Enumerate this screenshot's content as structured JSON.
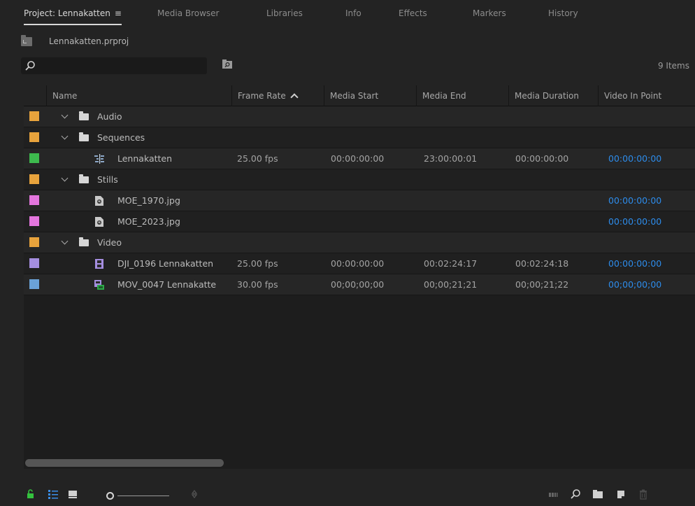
{
  "tabs": [
    {
      "label": "Project: Lennakatten",
      "menu": "≡",
      "active": true
    },
    {
      "label": "Media Browser",
      "active": false
    },
    {
      "label": "Libraries",
      "active": false
    },
    {
      "label": "Info",
      "active": false
    },
    {
      "label": "Effects",
      "active": false
    },
    {
      "label": "Markers",
      "active": false
    },
    {
      "label": "History",
      "active": false
    }
  ],
  "project": {
    "filename": "Lennakatten.prproj"
  },
  "search": {
    "value": "",
    "placeholder": ""
  },
  "items_count": "9 Items",
  "columns": [
    "Name",
    "Frame Rate",
    "Media Start",
    "Media End",
    "Media Duration",
    "Video In Point"
  ],
  "rows": [
    {
      "type": "bin",
      "name": "Audio",
      "label_color": "#e8a33c",
      "frame_rate": "",
      "media_start": "",
      "media_end": "",
      "media_duration": "",
      "video_in": ""
    },
    {
      "type": "bin",
      "name": "Sequences",
      "label_color": "#e8a33c",
      "frame_rate": "",
      "media_start": "",
      "media_end": "",
      "media_duration": "",
      "video_in": ""
    },
    {
      "type": "sequence",
      "name": "Lennakatten",
      "label_color": "#3dba4e",
      "frame_rate": "25.00 fps",
      "media_start": "00:00:00:00",
      "media_end": "23:00:00:01",
      "media_duration": "00:00:00:00",
      "video_in": "00:00:00:00"
    },
    {
      "type": "bin",
      "name": "Stills",
      "label_color": "#e8a33c",
      "frame_rate": "",
      "media_start": "",
      "media_end": "",
      "media_duration": "",
      "video_in": ""
    },
    {
      "type": "still",
      "name": "MOE_1970.jpg",
      "label_color": "#e476de",
      "frame_rate": "",
      "media_start": "",
      "media_end": "",
      "media_duration": "",
      "video_in": "00:00:00:00"
    },
    {
      "type": "still",
      "name": "MOE_2023.jpg",
      "label_color": "#e476de",
      "frame_rate": "",
      "media_start": "",
      "media_end": "",
      "media_duration": "",
      "video_in": "00:00:00:00"
    },
    {
      "type": "bin",
      "name": "Video",
      "label_color": "#e8a33c",
      "frame_rate": "",
      "media_start": "",
      "media_end": "",
      "media_duration": "",
      "video_in": ""
    },
    {
      "type": "video",
      "name": "DJI_0196 Lennakatten",
      "label_color": "#a58ee0",
      "frame_rate": "25.00 fps",
      "media_start": "00:00:00:00",
      "media_end": "00:02:24:17",
      "media_duration": "00:02:24:18",
      "video_in": "00:00:00:00"
    },
    {
      "type": "video-audio",
      "name": "MOV_0047 Lennakatte",
      "label_color": "#6aa2d8",
      "frame_rate": "30.00 fps",
      "media_start": "00;00;00;00",
      "media_end": "00;00;21;21",
      "media_duration": "00;00;21;22",
      "video_in": "00;00;00;00"
    }
  ],
  "colors": {
    "in_point": "#2d8ceb",
    "lock_icon": "#34c23e",
    "list_view_icon": "#3a8ee8"
  },
  "icons": {
    "lock": "lock-open-icon",
    "list_view": "list-view-icon",
    "icon_view": "icon-view-icon",
    "freeform": "freeform-view-icon",
    "sort": "sort-icons-icon",
    "automate": "automate-to-sequence-icon",
    "find": "search-icon",
    "new_bin": "new-bin-icon",
    "new_item": "new-item-icon",
    "clear": "trash-icon"
  }
}
